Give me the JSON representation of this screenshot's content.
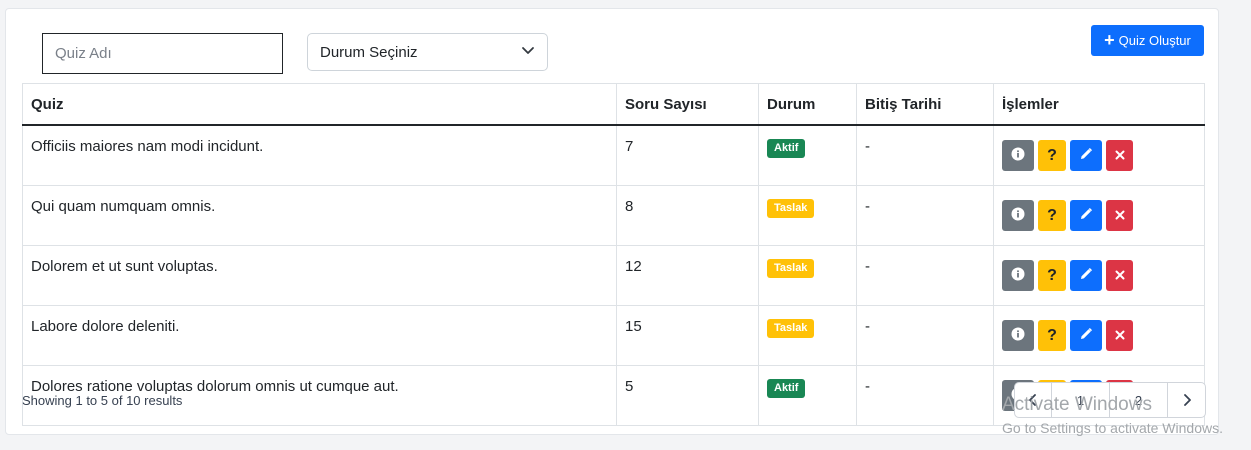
{
  "filters": {
    "search_placeholder": "Quiz Adı",
    "status_select": "Durum Seçiniz"
  },
  "toolbar": {
    "create_label": "Quiz Oluştur"
  },
  "table": {
    "headers": [
      "Quiz",
      "Soru Sayısı",
      "Durum",
      "Bitiş Tarihi",
      "İşlemler"
    ],
    "rows": [
      {
        "name": "Officiis maiores nam modi incidunt.",
        "count": "7",
        "status": "Aktif",
        "status_type": "aktif",
        "end": "-"
      },
      {
        "name": "Qui quam numquam omnis.",
        "count": "8",
        "status": "Taslak",
        "status_type": "taslak",
        "end": "-"
      },
      {
        "name": "Dolorem et ut sunt voluptas.",
        "count": "12",
        "status": "Taslak",
        "status_type": "taslak",
        "end": "-"
      },
      {
        "name": "Labore dolore deleniti.",
        "count": "15",
        "status": "Taslak",
        "status_type": "taslak",
        "end": "-"
      },
      {
        "name": "Dolores ratione voluptas dolorum omnis ut cumque aut.",
        "count": "5",
        "status": "Aktif",
        "status_type": "aktif",
        "end": "-"
      }
    ],
    "action_help_label": "?"
  },
  "footer": {
    "summary": "Showing 1 to 5 of 10 results",
    "pages": [
      "1",
      "2"
    ]
  },
  "watermark": {
    "line1": "Activate Windows",
    "line2": "Go to Settings to activate Windows."
  },
  "colors": {
    "primary": "#0d6efd",
    "success": "#198754",
    "warning": "#ffc107",
    "danger": "#dc3545",
    "secondary": "#6c757d"
  }
}
